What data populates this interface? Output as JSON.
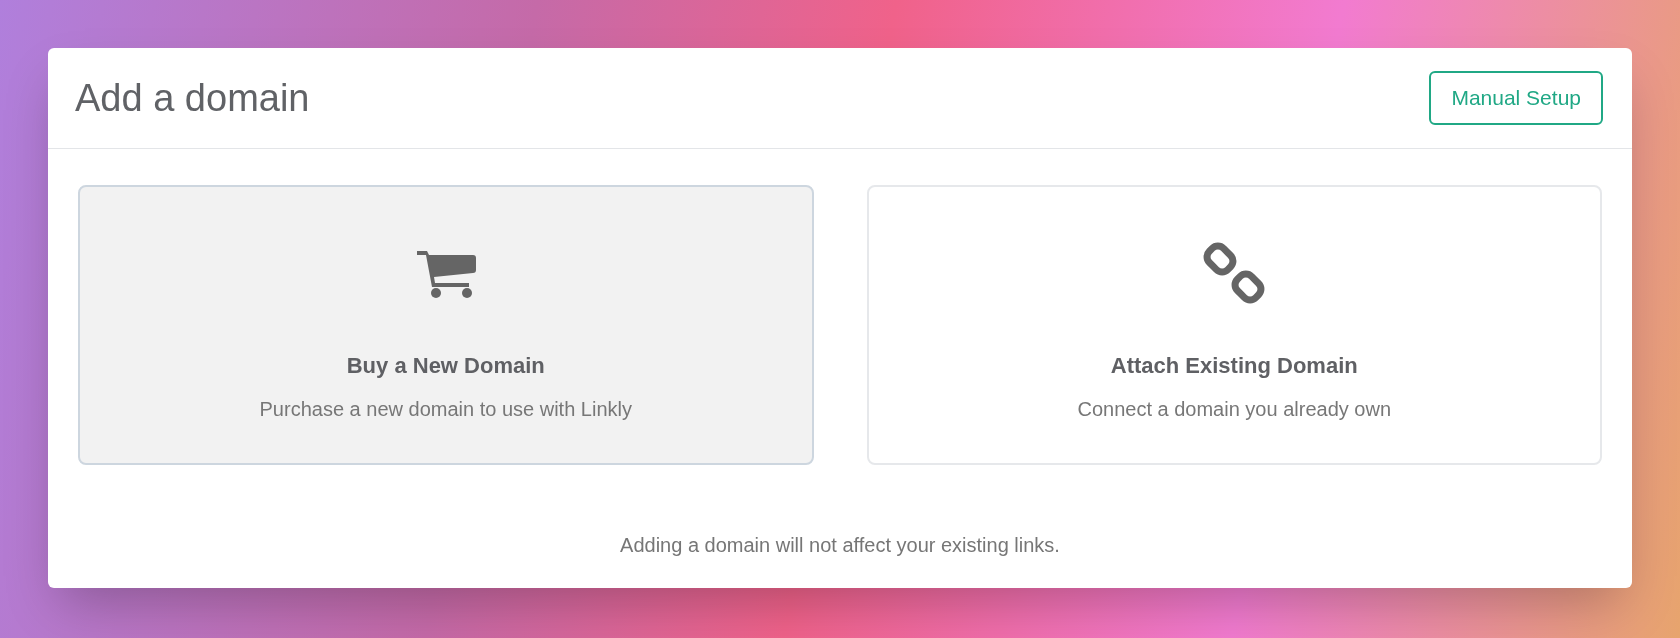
{
  "dialog": {
    "title": "Add a domain",
    "action_button": "Manual Setup"
  },
  "options": [
    {
      "kind": "cart",
      "title": "Buy a New Domain",
      "description": "Purchase a new domain to use with Linkly",
      "selected": true
    },
    {
      "kind": "link",
      "title": "Attach Existing Domain",
      "description": "Connect a domain you already own",
      "selected": false
    }
  ],
  "note": "Adding a domain will not affect your existing links."
}
